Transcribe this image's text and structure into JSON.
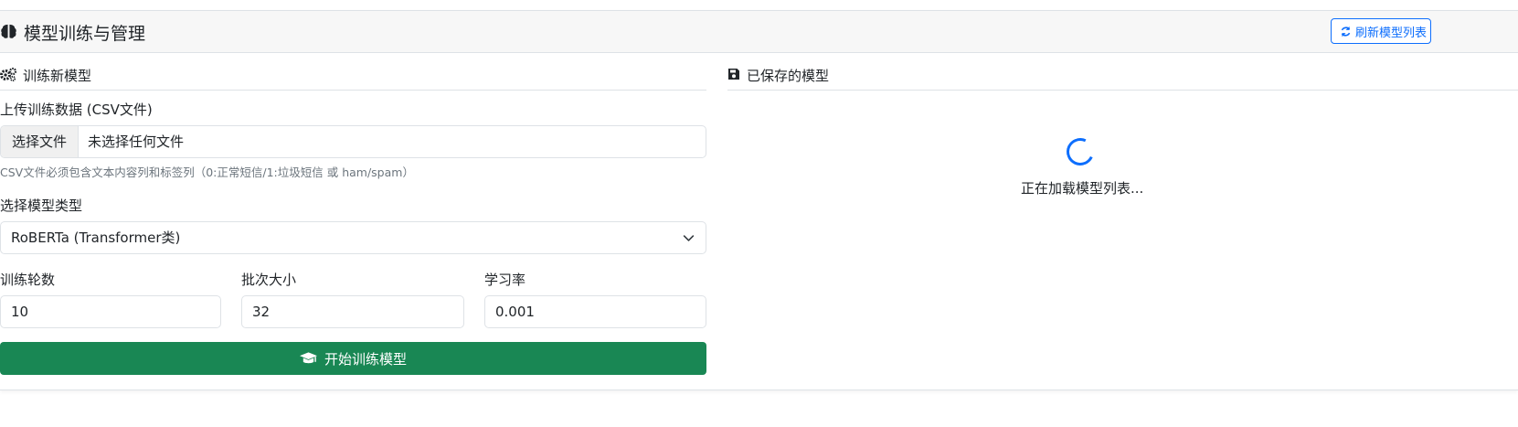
{
  "header": {
    "title": "模型训练与管理",
    "refresh_label": "刷新模型列表"
  },
  "train": {
    "section_title": "训练新模型",
    "upload_label": "上传训练数据 (CSV文件)",
    "file_button": "选择文件",
    "file_status": "未选择任何文件",
    "upload_help": "CSV文件必须包含文本内容列和标签列（0:正常短信/1:垃圾短信 或 ham/spam）",
    "model_type_label": "选择模型类型",
    "model_type_value": "RoBERTa (Transformer类)",
    "epochs_label": "训练轮数",
    "epochs_value": "10",
    "batch_label": "批次大小",
    "batch_value": "32",
    "lr_label": "学习率",
    "lr_value": "0.001",
    "submit_label": "开始训练模型"
  },
  "saved": {
    "section_title": "已保存的模型",
    "loading_text": "正在加载模型列表..."
  },
  "colors": {
    "primary": "#0d6efd",
    "success": "#198754",
    "border": "#dee2e6",
    "header_bg": "#f7f7f7"
  },
  "icons": {
    "header": "brain-icon",
    "refresh": "sync-icon",
    "train_section": "cogs-icon",
    "saved_section": "save-icon",
    "submit": "graduation-cap-icon",
    "select": "chevron-down-icon"
  }
}
